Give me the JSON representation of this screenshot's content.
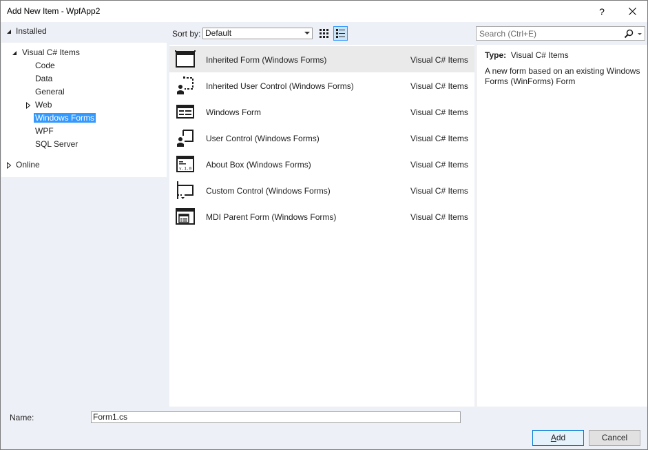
{
  "window": {
    "title": "Add New Item - WpfApp2",
    "help_glyph": "?"
  },
  "tree": {
    "installed": "Installed",
    "root": "Visual C# Items",
    "children": [
      "Code",
      "Data",
      "General",
      "Web",
      "Windows Forms",
      "WPF",
      "SQL Server"
    ],
    "selected": "Windows Forms",
    "online": "Online"
  },
  "toolbar": {
    "sort_label": "Sort by:",
    "sort_value": "Default"
  },
  "search": {
    "placeholder": "Search (Ctrl+E)"
  },
  "items": [
    {
      "name": "Inherited Form (Windows Forms)",
      "category": "Visual C# Items",
      "icon": "inherited-form-icon",
      "selected": true
    },
    {
      "name": "Inherited User Control (Windows Forms)",
      "category": "Visual C# Items",
      "icon": "inherited-user-control-icon"
    },
    {
      "name": "Windows Form",
      "category": "Visual C# Items",
      "icon": "windows-form-icon"
    },
    {
      "name": "User Control (Windows Forms)",
      "category": "Visual C# Items",
      "icon": "user-control-icon"
    },
    {
      "name": "About Box (Windows Forms)",
      "category": "Visual C# Items",
      "icon": "about-box-icon",
      "icon_text": "v.1.0"
    },
    {
      "name": "Custom Control (Windows Forms)",
      "category": "Visual C# Items",
      "icon": "custom-control-icon"
    },
    {
      "name": "MDI Parent Form (Windows Forms)",
      "category": "Visual C# Items",
      "icon": "mdi-parent-form-icon"
    }
  ],
  "details": {
    "type_label": "Type:",
    "type_value": "Visual C# Items",
    "description": "A new form based on an existing Windows Forms (WinForms) Form"
  },
  "footer": {
    "name_label": "Name:",
    "name_value": "Form1.cs",
    "add_first": "A",
    "add_rest": "dd",
    "cancel_label": "Cancel"
  }
}
